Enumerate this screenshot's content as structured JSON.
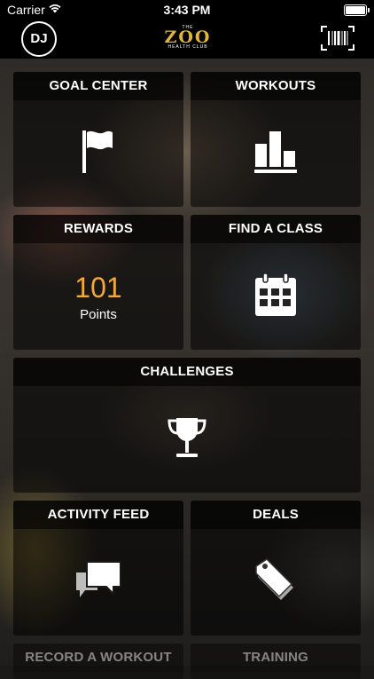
{
  "status_bar": {
    "carrier": "Carrier",
    "time": "3:43 PM"
  },
  "header": {
    "avatar_initials": "DJ",
    "logo_the": "THE",
    "logo_name": "ZOO",
    "logo_sub": "HEALTH CLUB"
  },
  "tiles": {
    "goal_center": "GOAL CENTER",
    "workouts": "WORKOUTS",
    "rewards": "REWARDS",
    "rewards_points": "101",
    "rewards_points_label": "Points",
    "find_a_class": "FIND A CLASS",
    "challenges": "CHALLENGES",
    "activity_feed": "ACTIVITY FEED",
    "deals": "DEALS",
    "record_a_workout": "RECORD A WORKOUT",
    "training": "TRAINING"
  },
  "icons": {
    "goal_center": "flag-icon",
    "workouts": "bar-chart-icon",
    "find_a_class": "calendar-icon",
    "challenges": "trophy-icon",
    "activity_feed": "chat-bubbles-icon",
    "deals": "tag-icon",
    "barcode": "barcode-scan-icon"
  },
  "colors": {
    "accent": "#f2a93a",
    "logo_gold": "#e0b63a"
  }
}
